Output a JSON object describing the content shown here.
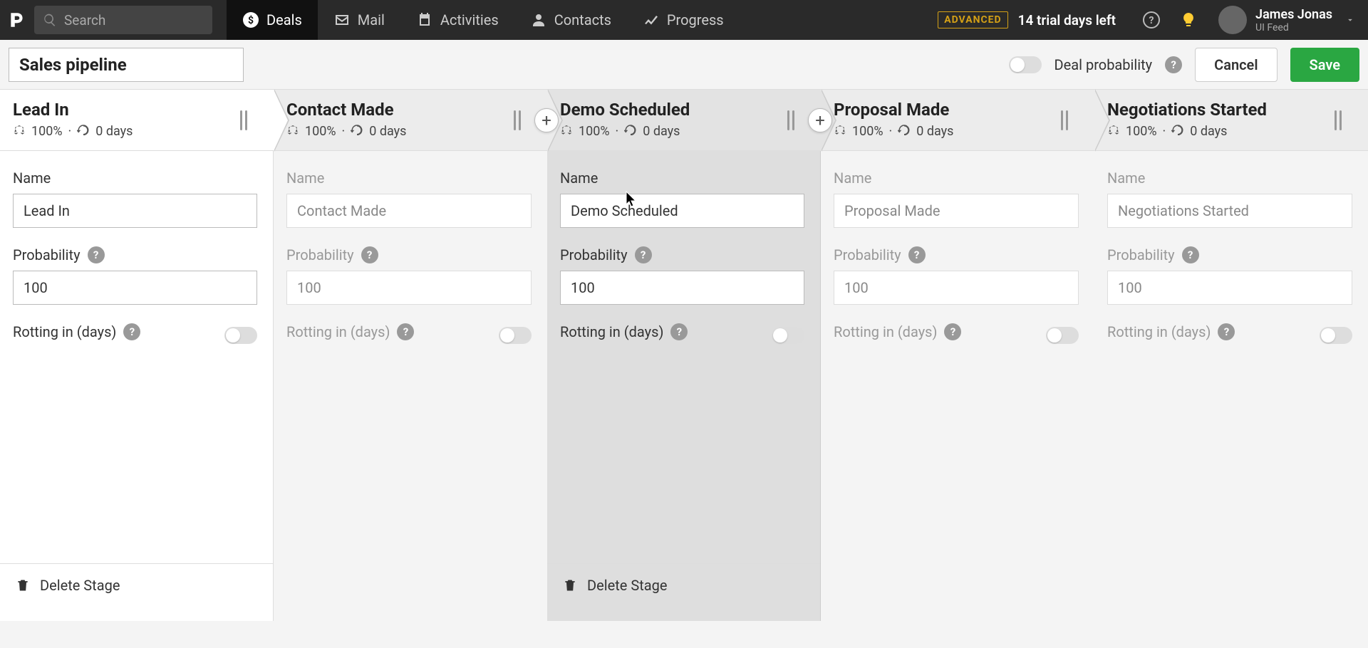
{
  "nav": {
    "search_placeholder": "Search",
    "items": [
      {
        "label": "Deals"
      },
      {
        "label": "Mail"
      },
      {
        "label": "Activities"
      },
      {
        "label": "Contacts"
      },
      {
        "label": "Progress"
      }
    ],
    "badge": "ADVANCED",
    "trial": "14 trial days left",
    "user_name": "James Jonas",
    "user_sub": "UI Feed"
  },
  "toolbar": {
    "pipeline_name": "Sales pipeline",
    "deal_prob": "Deal probability",
    "cancel": "Cancel",
    "save": "Save"
  },
  "labels": {
    "name": "Name",
    "probability": "Probability",
    "rotting": "Rotting in (days)",
    "delete": "Delete Stage"
  },
  "stages": [
    {
      "title": "Lead In",
      "prob": "100%",
      "days": "0 days",
      "name_val": "Lead In",
      "prob_val": "100",
      "state": "active"
    },
    {
      "title": "Contact Made",
      "prob": "100%",
      "days": "0 days",
      "name_val": "Contact Made",
      "prob_val": "100",
      "state": "dim"
    },
    {
      "title": "Demo Scheduled",
      "prob": "100%",
      "days": "0 days",
      "name_val": "Demo Scheduled",
      "prob_val": "100",
      "state": "highlight"
    },
    {
      "title": "Proposal Made",
      "prob": "100%",
      "days": "0 days",
      "name_val": "Proposal Made",
      "prob_val": "100",
      "state": "dim"
    },
    {
      "title": "Negotiations Started",
      "prob": "100%",
      "days": "0 days",
      "name_val": "Negotiations Started",
      "prob_val": "100",
      "state": "dim"
    }
  ]
}
